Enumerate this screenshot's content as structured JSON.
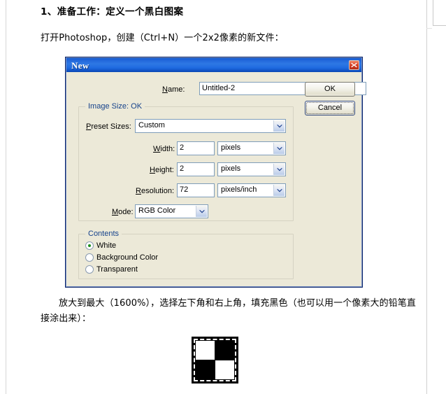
{
  "document": {
    "heading": "1、准备工作：定义一个黑白图案",
    "paragraph_1": "打开Photoshop，创建（Ctrl+N）一个2x2像素的新文件：",
    "paragraph_2": "放大到最大（1600%），选择左下角和右上角，填充黑色（也可以用一个像素大的铅笔直接涂出来）："
  },
  "dialog": {
    "title": "New",
    "close_icon": "close-icon",
    "name": {
      "label": "Name:",
      "value": "Untitled-2"
    },
    "buttons": {
      "ok": "OK",
      "cancel": "Cancel"
    },
    "image_size": {
      "group_title": "Image Size: OK",
      "preset_sizes": {
        "label": "Preset Sizes:",
        "value": "Custom"
      },
      "width": {
        "label": "Width:",
        "value": "2",
        "unit": "pixels"
      },
      "height": {
        "label": "Height:",
        "value": "2",
        "unit": "pixels"
      },
      "resolution": {
        "label": "Resolution:",
        "value": "72",
        "unit": "pixels/inch"
      },
      "mode": {
        "label": "Mode:",
        "value": "RGB Color"
      }
    },
    "contents": {
      "group_title": "Contents",
      "options": [
        {
          "label": "White",
          "selected": true
        },
        {
          "label": "Background Color",
          "selected": false
        },
        {
          "label": "Transparent",
          "selected": false
        }
      ]
    }
  },
  "figure": {
    "name": "checkerboard-2x2-pattern",
    "quadrants": {
      "top_left": "#ffffff",
      "top_right": "#000000",
      "bottom_left": "#000000",
      "bottom_right": "#ffffff"
    },
    "selection_border": "marching-ants-dashed-white"
  },
  "colors": {
    "dialog_face": "#ece9d8",
    "titlebar_blue": "#1f63d8",
    "group_title_blue": "#15428b",
    "field_border": "#7f9db9",
    "radio_selected": "#1d8f1d",
    "close_red": "#d8442a"
  }
}
